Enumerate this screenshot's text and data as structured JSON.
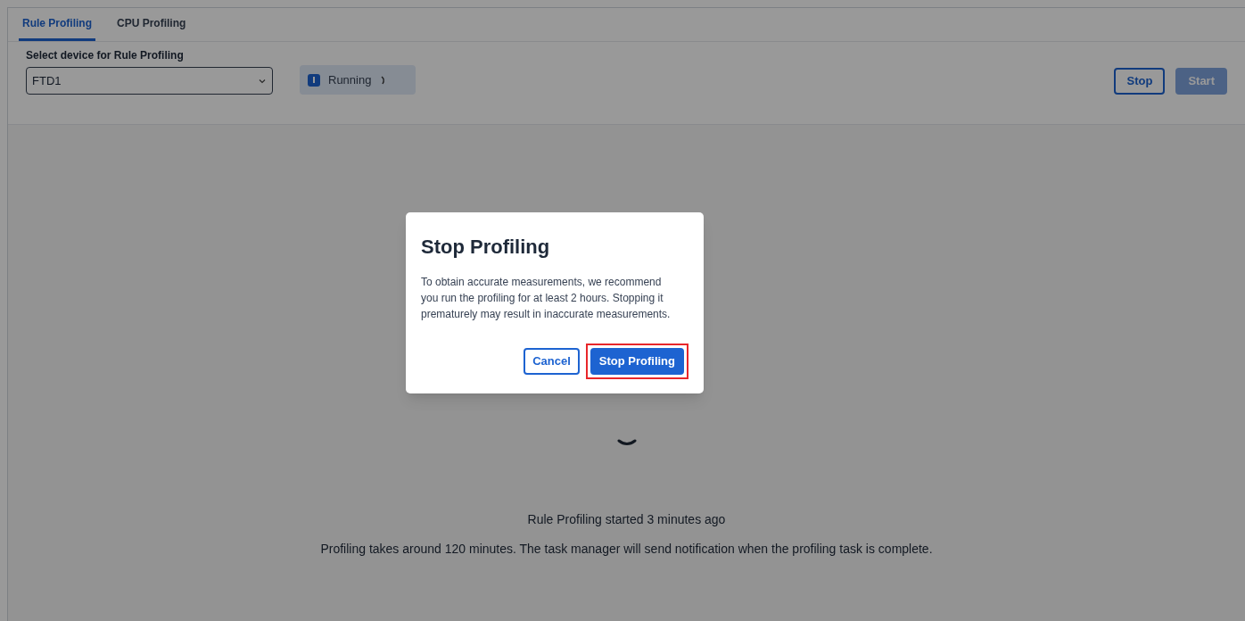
{
  "tabs": [
    {
      "label": "Rule Profiling",
      "selected": true
    },
    {
      "label": "CPU Profiling",
      "selected": false
    }
  ],
  "device_select": {
    "label": "Select device for Rule Profiling",
    "value": "FTD1"
  },
  "status": {
    "label": "Running",
    "busy": true
  },
  "actions": [
    {
      "label": "Stop",
      "kind": "secondary",
      "disabled": false
    },
    {
      "label": "Start",
      "kind": "primary",
      "disabled": true
    }
  ],
  "progress": {
    "busy": true,
    "started": "Rule Profiling started 3 minutes ago",
    "note": "Profiling takes around 120 minutes. The task manager will send notification when the profiling task is complete."
  },
  "dialog": {
    "title": "Stop Profiling",
    "message": "To obtain accurate measurements, we recommend you run the profiling for at least 2 hours. Stopping it prematurely may result in inaccurate measurements.",
    "buttons": [
      {
        "label": "Cancel",
        "kind": "secondary",
        "highlighted": false
      },
      {
        "label": "Stop Profiling",
        "kind": "primary",
        "highlighted": true
      }
    ]
  }
}
